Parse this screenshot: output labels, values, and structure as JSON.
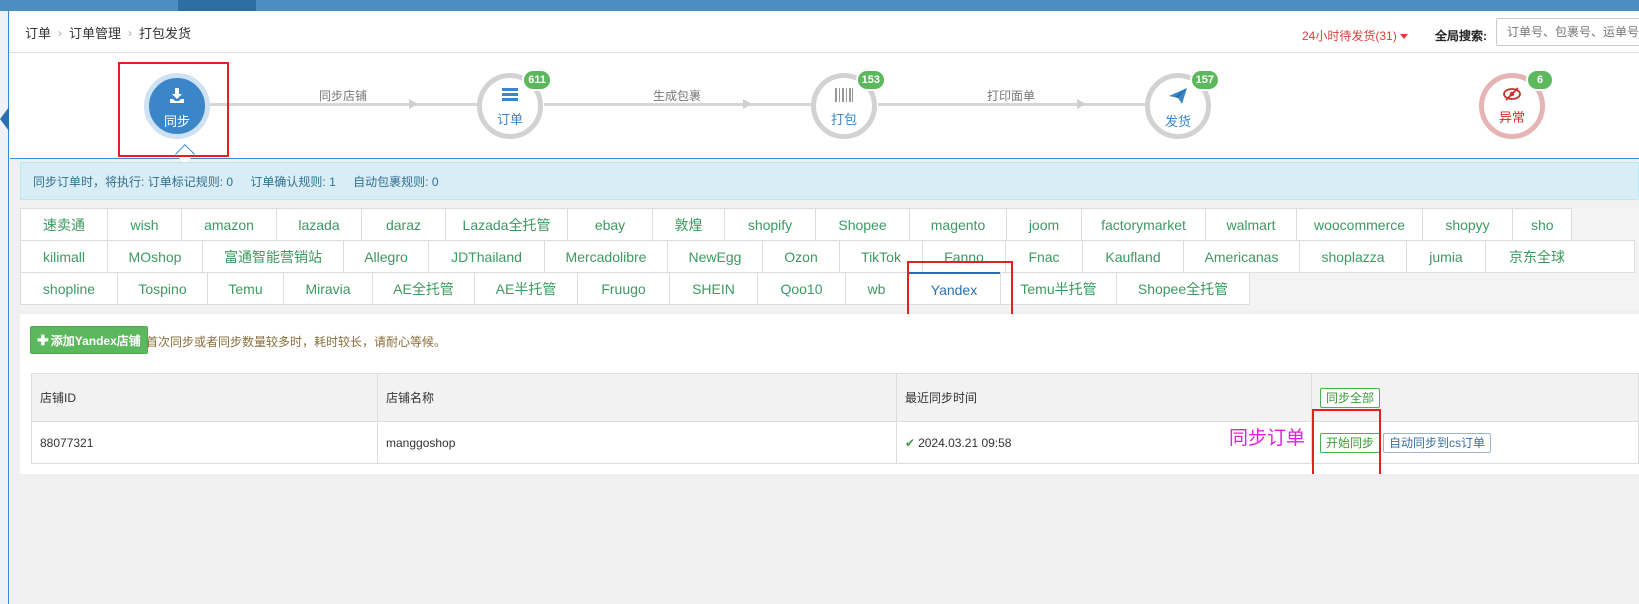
{
  "breadcrumb": [
    "订单",
    "订单管理",
    "打包发货"
  ],
  "header": {
    "pending": "24小时待发货(31)",
    "search_label": "全局搜索:",
    "search_placeholder": "订单号、包裹号、运单号"
  },
  "steps": [
    {
      "label": "同步",
      "icon": "download-icon",
      "badge": ""
    },
    {
      "label": "订单",
      "icon": "list-icon",
      "badge": "611"
    },
    {
      "label": "打包",
      "icon": "barcode-icon",
      "badge": "153"
    },
    {
      "label": "发货",
      "icon": "paper-plane-icon",
      "badge": "157"
    },
    {
      "label": "异常",
      "icon": "eye-slash-icon",
      "badge": "6"
    }
  ],
  "step_links": [
    "同步店铺",
    "生成包裹",
    "打印面单"
  ],
  "rules": {
    "prefix": "同步订单时，将执行:",
    "mark_label": "订单标记规则:",
    "mark_value": "0",
    "confirm_label": "订单确认规则:",
    "confirm_value": "1",
    "pack_label": "自动包裹规则:",
    "pack_value": "0"
  },
  "platform_tabs": {
    "row1": [
      "速卖通",
      "wish",
      "amazon",
      "lazada",
      "daraz",
      "Lazada全托管",
      "ebay",
      "敦煌",
      "shopify",
      "Shopee",
      "magento",
      "joom",
      "factorymarket",
      "walmart",
      "woocommerce",
      "shopyy",
      "sho"
    ],
    "row2": [
      "kilimall",
      "MOshop",
      "富通智能营销站",
      "Allegro",
      "JDThailand",
      "Mercadolibre",
      "NewEgg",
      "Ozon",
      "TikTok",
      "Fanno",
      "Fnac",
      "Kaufland",
      "Americanas",
      "shoplazza",
      "jumia",
      "京东全球"
    ],
    "row3": [
      "shopline",
      "Tospino",
      "Temu",
      "Miravia",
      "AE全托管",
      "AE半托管",
      "Fruugo",
      "SHEIN",
      "Qoo10",
      "wb",
      "Yandex",
      "Temu半托管",
      "Shopee全托管"
    ],
    "active": "Yandex"
  },
  "content": {
    "add_button": "添加Yandex店铺",
    "hint": "首次同步或者同步数量较多时，耗时较长，请耐心等候。"
  },
  "table": {
    "headers": [
      "店铺ID",
      "店铺名称",
      "最近同步时间"
    ],
    "sync_all": "同步全部",
    "rows": [
      {
        "id": "88077321",
        "name": "manggoshop",
        "time": "2024.03.21 09:58",
        "start": "开始同步",
        "auto": "自动同步到cs订单"
      }
    ]
  },
  "annotation": "同步订单",
  "colors": {
    "accent": "#3a86c8",
    "green": "#5cb85c",
    "red": "#e62020",
    "annotation": "#e020e0"
  }
}
